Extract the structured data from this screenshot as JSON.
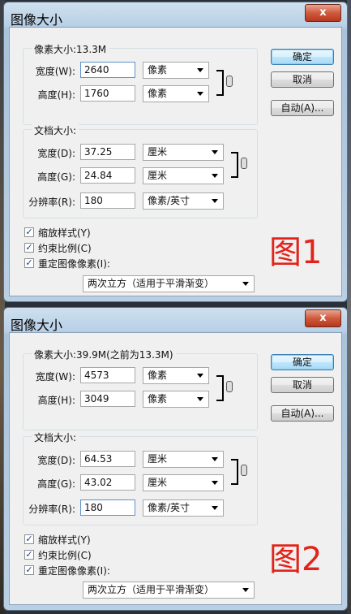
{
  "dialog1": {
    "title": "图像大小",
    "close": "x",
    "pixel_dimensions_label": "像素大小:13.3M",
    "width_label": "宽度(W):",
    "width_value": "2640",
    "width_unit": "像素",
    "height_label": "高度(H):",
    "height_value": "1760",
    "height_unit": "像素",
    "doc_size_label": "文档大小:",
    "doc_width_label": "宽度(D):",
    "doc_width_value": "37.25",
    "doc_width_unit": "厘米",
    "doc_height_label": "高度(G):",
    "doc_height_value": "24.84",
    "doc_height_unit": "厘米",
    "resolution_label": "分辨率(R):",
    "resolution_value": "180",
    "resolution_unit": "像素/英寸",
    "ok": "确定",
    "cancel": "取消",
    "auto": "自动(A)...",
    "scale_styles": "缩放样式(Y)",
    "constrain": "约束比例(C)",
    "resample": "重定图像像素(I):",
    "resample_method": "两次立方（适用于平滑渐变）",
    "annotation": "图1"
  },
  "dialog2": {
    "title": "图像大小",
    "close": "x",
    "pixel_dimensions_label": "像素大小:39.9M(之前为13.3M)",
    "width_label": "宽度(W):",
    "width_value": "4573",
    "width_unit": "像素",
    "height_label": "高度(H):",
    "height_value": "3049",
    "height_unit": "像素",
    "doc_size_label": "文档大小:",
    "doc_width_label": "宽度(D):",
    "doc_width_value": "64.53",
    "doc_width_unit": "厘米",
    "doc_height_label": "高度(G):",
    "doc_height_value": "43.02",
    "doc_height_unit": "厘米",
    "resolution_label": "分辨率(R):",
    "resolution_value": "180",
    "resolution_unit": "像素/英寸",
    "ok": "确定",
    "cancel": "取消",
    "auto": "自动(A)...",
    "scale_styles": "缩放样式(Y)",
    "constrain": "约束比例(C)",
    "resample": "重定图像像素(I):",
    "resample_method": "两次立方（适用于平滑渐变）",
    "annotation": "图2"
  },
  "checkbox_mark": "✓",
  "colors": {
    "annotation": "#e2231a",
    "titlebar": "#b9d0e6",
    "close_button": "#cf5a3d"
  }
}
